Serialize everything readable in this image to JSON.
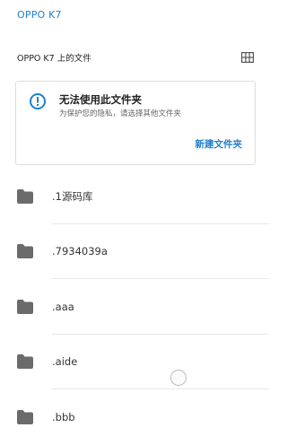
{
  "header": {
    "app_title": "OPPO K7"
  },
  "section": {
    "label": "OPPO K7 上的文件",
    "view_toggle_icon": "grid-view-icon"
  },
  "notice": {
    "icon": "info-icon",
    "title": "无法使用此文件夹",
    "subtitle": "为保护您的隐私，请选择其他文件夹",
    "action_label": "新建文件夹"
  },
  "files": [
    {
      "name": ".1源码库",
      "icon": "folder-icon"
    },
    {
      "name": ".7934039a",
      "icon": "folder-icon"
    },
    {
      "name": ".aaa",
      "icon": "folder-icon"
    },
    {
      "name": ".aide",
      "icon": "folder-icon"
    },
    {
      "name": ".bbb",
      "icon": "folder-icon"
    }
  ],
  "colors": {
    "accent": "#1f7fd0",
    "folder": "#6b6b6b",
    "divider": "#e6e6e6"
  }
}
